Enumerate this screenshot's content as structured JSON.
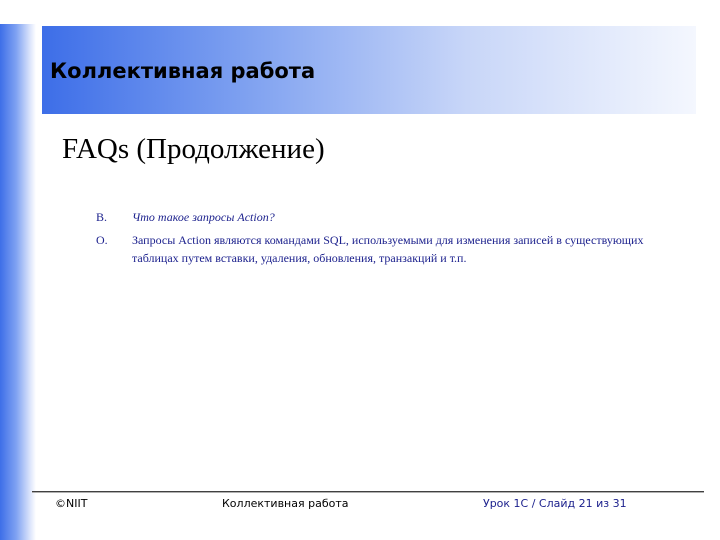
{
  "header": {
    "title": "Коллективная работа"
  },
  "slide": {
    "heading": "FAQs (Продолжение)",
    "faq": [
      {
        "marker": "В.",
        "text": "Что такое запросы Action?",
        "style": "question"
      },
      {
        "marker": "О.",
        "text": "Запросы Action являются командами SQL, используемыми для изменения записей в существующих таблицах путем вставки, удаления, обновления, транзакций и т.п.",
        "style": "answer"
      }
    ]
  },
  "footer": {
    "copyright": "©NIIT",
    "center": "Коллективная работа",
    "page": "Урок 1C / Слайд 21 из 31"
  },
  "colors": {
    "accent_blue": "#3d6ee8",
    "text_navy": "#1a1f8c"
  }
}
